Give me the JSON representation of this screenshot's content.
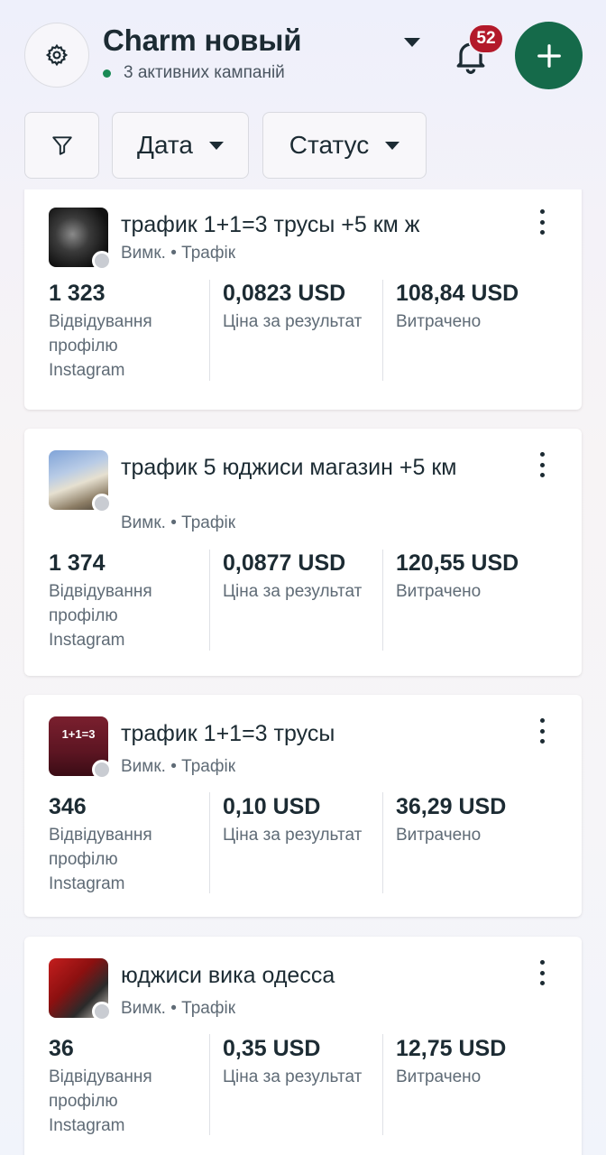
{
  "header": {
    "account_name": "Charm новый",
    "active_campaigns": "3 активних кампаній",
    "notifications_count": "52"
  },
  "filters": {
    "date_label": "Дата",
    "status_label": "Статус"
  },
  "campaigns": [
    {
      "title": "трафик 1+1=3 трусы +5 км ж",
      "status": "Вимк.",
      "objective": "Трафік",
      "metrics": [
        {
          "value": "1 323",
          "label": "Відвідування профілю Instagram"
        },
        {
          "value": "0,0823 USD",
          "label": "Ціна за результат"
        },
        {
          "value": "108,84 USD",
          "label": "Витрачено"
        }
      ]
    },
    {
      "title": "трафик 5 юджиси магазин +5 км",
      "status": "Вимк.",
      "objective": "Трафік",
      "metrics": [
        {
          "value": "1 374",
          "label": "Відвідування профілю Instagram"
        },
        {
          "value": "0,0877 USD",
          "label": "Ціна за результат"
        },
        {
          "value": "120,55 USD",
          "label": "Витрачено"
        }
      ]
    },
    {
      "title": "трафик 1+1=3 трусы",
      "status": "Вимк.",
      "objective": "Трафік",
      "thumb_text": "1+1=3",
      "metrics": [
        {
          "value": "346",
          "label": "Відвідування профілю Instagram"
        },
        {
          "value": "0,10 USD",
          "label": "Ціна за результат"
        },
        {
          "value": "36,29 USD",
          "label": "Витрачено"
        }
      ]
    },
    {
      "title": "юджиси вика одесса",
      "status": "Вимк.",
      "objective": "Трафік",
      "metrics": [
        {
          "value": "36",
          "label": "Відвідування профілю Instagram"
        },
        {
          "value": "0,35 USD",
          "label": "Ціна за результат"
        },
        {
          "value": "12,75 USD",
          "label": "Витрачено"
        }
      ]
    }
  ],
  "separator": "•",
  "colors": {
    "accent_green": "#156a4a",
    "badge_red": "#b3192a",
    "active_dot": "#1a8a55"
  },
  "icons": [
    "gear-icon",
    "chevron-down-icon",
    "bell-icon",
    "plus-icon",
    "filter-icon",
    "more-vertical-icon"
  ]
}
